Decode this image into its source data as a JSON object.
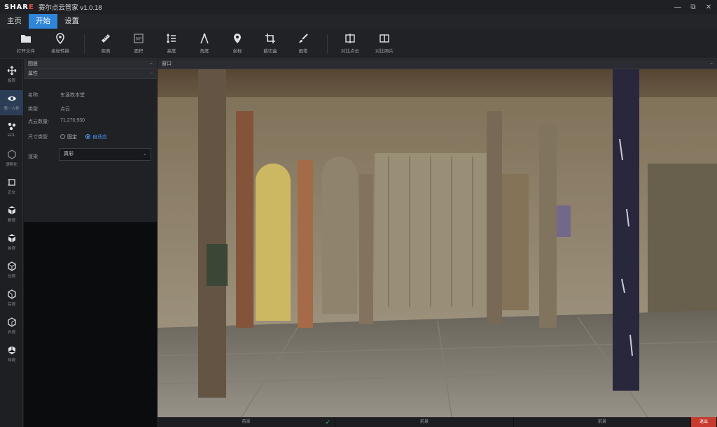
{
  "titlebar": {
    "logo_prefix": "SHAR",
    "logo_accent": "E",
    "title": "赛尔点云管家 v1.0.18",
    "minimize": "—",
    "restore": "⧉",
    "close": "✕"
  },
  "menubar": {
    "items": [
      {
        "label": "主页",
        "active": false
      },
      {
        "label": "开始",
        "active": true
      },
      {
        "label": "设置",
        "active": false
      }
    ]
  },
  "toolbar": {
    "tools": [
      {
        "label": "打开文件",
        "icon": "folder-icon"
      },
      {
        "label": "坐标转换",
        "icon": "location-pin-icon"
      },
      {
        "label": "距离",
        "icon": "ruler-icon"
      },
      {
        "label": "面积",
        "icon": "area-icon"
      },
      {
        "label": "高度",
        "icon": "height-icon"
      },
      {
        "label": "角度",
        "icon": "angle-icon"
      },
      {
        "label": "坐标",
        "icon": "point-icon"
      },
      {
        "label": "截切盒",
        "icon": "crop-box-icon"
      },
      {
        "label": "画笔",
        "icon": "brush-icon"
      },
      {
        "label": "对比点云",
        "icon": "compare-cloud-icon"
      },
      {
        "label": "对比照片",
        "icon": "compare-photo-icon"
      }
    ]
  },
  "rail": {
    "items": [
      {
        "label": "旋转",
        "icon": "move-icon",
        "active": false
      },
      {
        "label": "第一人称",
        "icon": "eye-icon",
        "active": true
      },
      {
        "label": "EDL",
        "icon": "edl-icon",
        "active": false
      },
      {
        "label": "透明化",
        "icon": "transparent-cube-icon",
        "active": false
      },
      {
        "label": "正交",
        "icon": "ortho-icon",
        "active": false
      },
      {
        "label": "俯视",
        "icon": "top-view-icon",
        "active": false
      },
      {
        "label": "前视",
        "icon": "front-view-icon",
        "active": false
      },
      {
        "label": "左视",
        "icon": "left-view-icon",
        "active": false
      },
      {
        "label": "后视",
        "icon": "back-view-icon",
        "active": false
      },
      {
        "label": "右视",
        "icon": "right-view-icon",
        "active": false
      },
      {
        "label": "仰视",
        "icon": "bottom-view-icon",
        "active": false
      }
    ]
  },
  "panel": {
    "layers_title": "图层",
    "props_title": "属性",
    "collapse": "−",
    "name_label": "名称:",
    "name_value": "车溪牧本堂",
    "type_label": "类型:",
    "type_value": "点云",
    "count_label": "点云数量:",
    "count_value": "71,270,930",
    "size_label": "尺寸类型",
    "size_fixed": "固定",
    "size_adaptive": "自适应",
    "size_selected": "自适应",
    "render_label": "渲染",
    "render_value": "真彩"
  },
  "viewport": {
    "title": "窗口",
    "collapse": "−"
  },
  "statusbar": {
    "segments": [
      "前景",
      "前景",
      "前景",
      "退出"
    ],
    "ok_mark": "✓"
  },
  "colors": {
    "accent": "#2f86d9",
    "active_rail": "#2c3e57",
    "close_red": "#c8392e"
  }
}
